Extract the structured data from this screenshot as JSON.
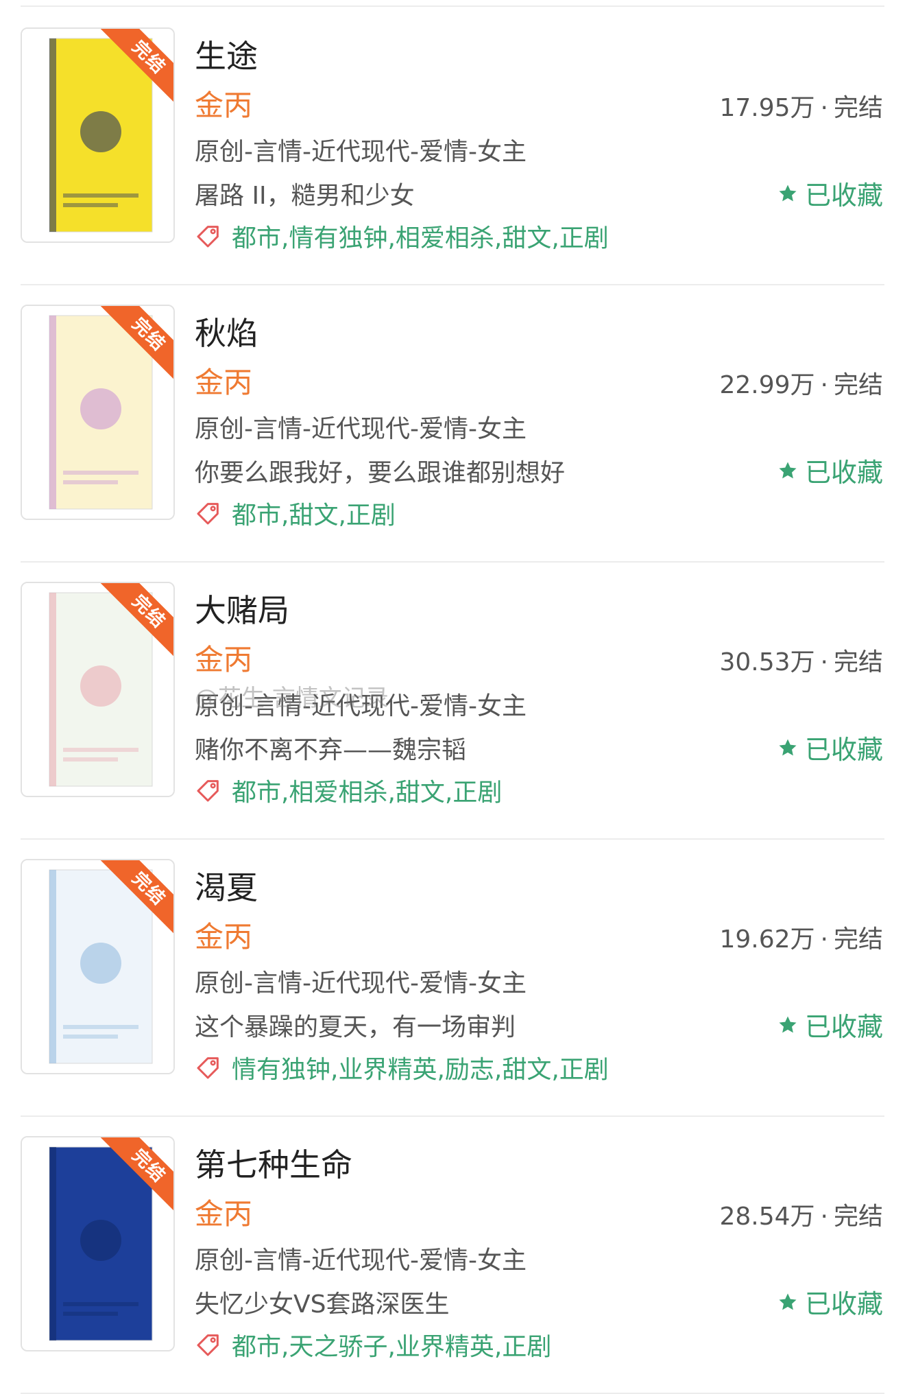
{
  "colors": {
    "author": "#ef7a32",
    "tag_text": "#3aa373",
    "favorite": "#3aa373",
    "ribbon": "#f0652a"
  },
  "books": [
    {
      "title": "生途",
      "author": "金丙",
      "views": "17.95万",
      "status": "完结",
      "category": "原创-言情-近代现代-爱情-女主",
      "intro": "屠路 II，糙男和少女",
      "favorite_label": "已收藏",
      "tags": "都市,情有独钟,相爱相杀,甜文,正剧",
      "ribbon": "完结",
      "cover_colors": [
        "#f5e02a",
        "#1b2a5e"
      ]
    },
    {
      "title": "秋焰",
      "author": "金丙",
      "views": "22.99万",
      "status": "完结",
      "category": "原创-言情-近代现代-爱情-女主",
      "intro": "你要么跟我好，要么跟谁都别想好",
      "favorite_label": "已收藏",
      "tags": "都市,甜文,正剧",
      "ribbon": "完结",
      "cover_colors": [
        "#fbf3cf",
        "#c98fd6"
      ]
    },
    {
      "title": "大赌局",
      "author": "金丙",
      "views": "30.53万",
      "status": "完结",
      "category": "原创-言情-近代现代-爱情-女主",
      "intro": "赌你不离不弃——魏宗韬",
      "favorite_label": "已收藏",
      "tags": "都市,相爱相杀,甜文,正剧",
      "ribbon": "完结",
      "cover_colors": [
        "#f2f6ee",
        "#e9a7b1"
      ]
    },
    {
      "title": "渴夏",
      "author": "金丙",
      "views": "19.62万",
      "status": "完结",
      "category": "原创-言情-近代现代-爱情-女主",
      "intro": "这个暴躁的夏天，有一场审判",
      "favorite_label": "已收藏",
      "tags": "情有独钟,业界精英,励志,甜文,正剧",
      "ribbon": "完结",
      "cover_colors": [
        "#eef4fa",
        "#8fb8dc"
      ]
    },
    {
      "title": "第七种生命",
      "author": "金丙",
      "views": "28.54万",
      "status": "完结",
      "category": "原创-言情-近代现代-爱情-女主",
      "intro": "失忆少女VS套路深医生",
      "favorite_label": "已收藏",
      "tags": "都市,天之骄子,业界精英,正剧",
      "ribbon": "完结",
      "cover_colors": [
        "#1d3f9a",
        "#102a6a"
      ]
    }
  ],
  "watermark": "@花生·言情文记录"
}
